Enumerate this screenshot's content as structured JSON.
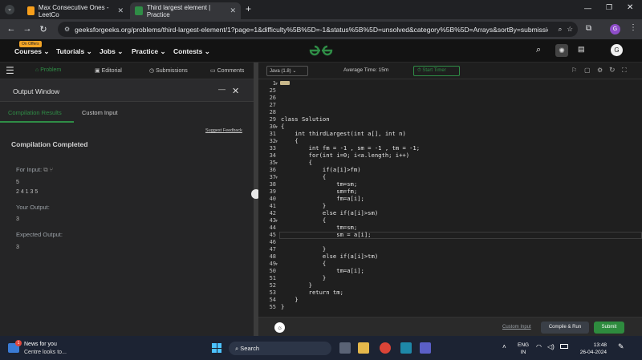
{
  "browser": {
    "tabs": [
      {
        "label": "Max Consecutive Ones - LeetCo",
        "active": false
      },
      {
        "label": "Third largest element | Practice",
        "active": true
      }
    ],
    "url": "geeksforgeeks.org/problems/third-largest-element/1?page=1&difficulty%5B%5D=-1&status%5B%5D=unsolved&category%5B%5D=Arrays&sortBy=submissions",
    "profile_letter": "G"
  },
  "site": {
    "logo": "GG",
    "badge": "On Offers",
    "nav": [
      "Courses",
      "Tutorials",
      "Jobs",
      "Practice",
      "Contests"
    ],
    "avatar_letter": "G"
  },
  "toolbar": {
    "tabs": [
      "Problem",
      "Editorial",
      "Submissions",
      "Comments"
    ],
    "language": "Java (1.8)",
    "avg_time": "Average Time: 15m",
    "start_timer": "Start Timer"
  },
  "output": {
    "title": "Output Window",
    "tabs": [
      "Compilation Results",
      "Custom Input"
    ],
    "suggest": "Suggest Feedback",
    "status": "Compilation Completed",
    "for_input_label": "For Input:",
    "input_line1": "5",
    "input_line2": "2 4 1 3 5",
    "your_output_label": "Your Output:",
    "your_output": "3",
    "expected_label": "Expected Output:",
    "expected": "3"
  },
  "editor": {
    "lines": [
      {
        "n": "1",
        "code": ""
      },
      {
        "n": "25",
        "code": ""
      },
      {
        "n": "26",
        "code": ""
      },
      {
        "n": "27",
        "code": ""
      },
      {
        "n": "28",
        "code": ""
      },
      {
        "n": "29",
        "code": "class Solution"
      },
      {
        "n": "30",
        "code": "{"
      },
      {
        "n": "31",
        "code": "    int thirdLargest(int a[], int n)"
      },
      {
        "n": "32",
        "code": "    {"
      },
      {
        "n": "33",
        "code": "        int fm = -1 , sm = -1 , tm = -1;"
      },
      {
        "n": "34",
        "code": "        for(int i=0; i<a.length; i++)"
      },
      {
        "n": "35",
        "code": "        {"
      },
      {
        "n": "36",
        "code": "            if(a[i]>fm)"
      },
      {
        "n": "37",
        "code": "            {"
      },
      {
        "n": "38",
        "code": "                tm=sm;"
      },
      {
        "n": "39",
        "code": "                sm=fm;"
      },
      {
        "n": "40",
        "code": "                fm=a[i];"
      },
      {
        "n": "41",
        "code": "            }"
      },
      {
        "n": "42",
        "code": "            else if(a[i]>sm)"
      },
      {
        "n": "43",
        "code": "            {"
      },
      {
        "n": "44",
        "code": "                tm=sm;"
      },
      {
        "n": "45",
        "code": "                sm = a[i];"
      },
      {
        "n": "46",
        "code": ""
      },
      {
        "n": "47",
        "code": "            }"
      },
      {
        "n": "48",
        "code": "            else if(a[i]>tm)"
      },
      {
        "n": "49",
        "code": "            {"
      },
      {
        "n": "50",
        "code": "                tm=a[i];"
      },
      {
        "n": "51",
        "code": "            }"
      },
      {
        "n": "52",
        "code": "        }"
      },
      {
        "n": "53",
        "code": "        return tm;"
      },
      {
        "n": "54",
        "code": "    }"
      },
      {
        "n": "55",
        "code": "}"
      }
    ]
  },
  "actions": {
    "custom_input": "Custom Input",
    "compile_run": "Compile & Run",
    "submit": "Submit"
  },
  "taskbar": {
    "news_title": "News for you",
    "news_sub": "Centre looks to...",
    "news_badge": "1",
    "search": "Search",
    "lang1": "ENG",
    "lang2": "IN",
    "time": "13:48",
    "date": "26-04-2024"
  },
  "colors": {
    "gfg_green": "#2f8d46",
    "submit_green": "#2e8b3e",
    "editor_bg": "#1f1f1f"
  }
}
